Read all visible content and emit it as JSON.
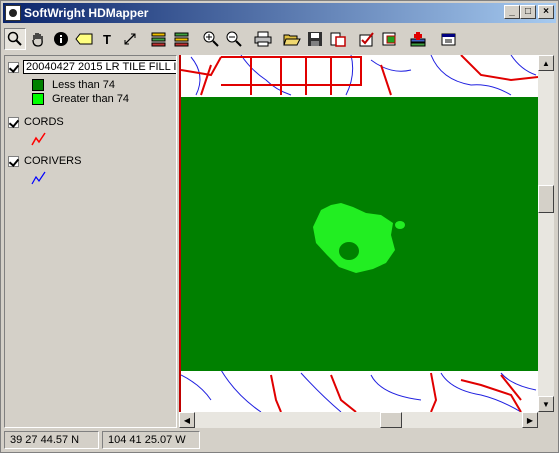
{
  "window": {
    "title": "SoftWright HDMapper"
  },
  "caption_buttons": {
    "minimize": "_",
    "maximize": "□",
    "close": "×"
  },
  "toolbar": {
    "tools": [
      "zoom",
      "pan",
      "info",
      "label",
      "text",
      "line",
      "layers-up",
      "layers-down",
      "zoom-in",
      "zoom-out",
      "print",
      "open",
      "save",
      "export",
      "edit-layer",
      "layer-props",
      "add-layer",
      "layer-list"
    ],
    "text_tool": "T"
  },
  "legend": {
    "layers": [
      {
        "name": "20040427 2015 LR TILE FILL I",
        "checked": true,
        "classes": [
          {
            "label": "Less than 74",
            "color": "#008000"
          },
          {
            "label": "Greater than 74",
            "color": "#00ff00"
          }
        ]
      },
      {
        "name": "CORDS",
        "checked": true,
        "symbol_color": "#ff0000"
      },
      {
        "name": "CORIVERS",
        "checked": true,
        "symbol_color": "#0000ff"
      }
    ]
  },
  "map": {
    "fill_color": "#008000",
    "highlight_color": "#22ee22",
    "road_color": "#e00000",
    "river_color": "#2020e0"
  },
  "status": {
    "latitude": "39 27 44.57 N",
    "longitude": "104 41 25.07 W"
  }
}
